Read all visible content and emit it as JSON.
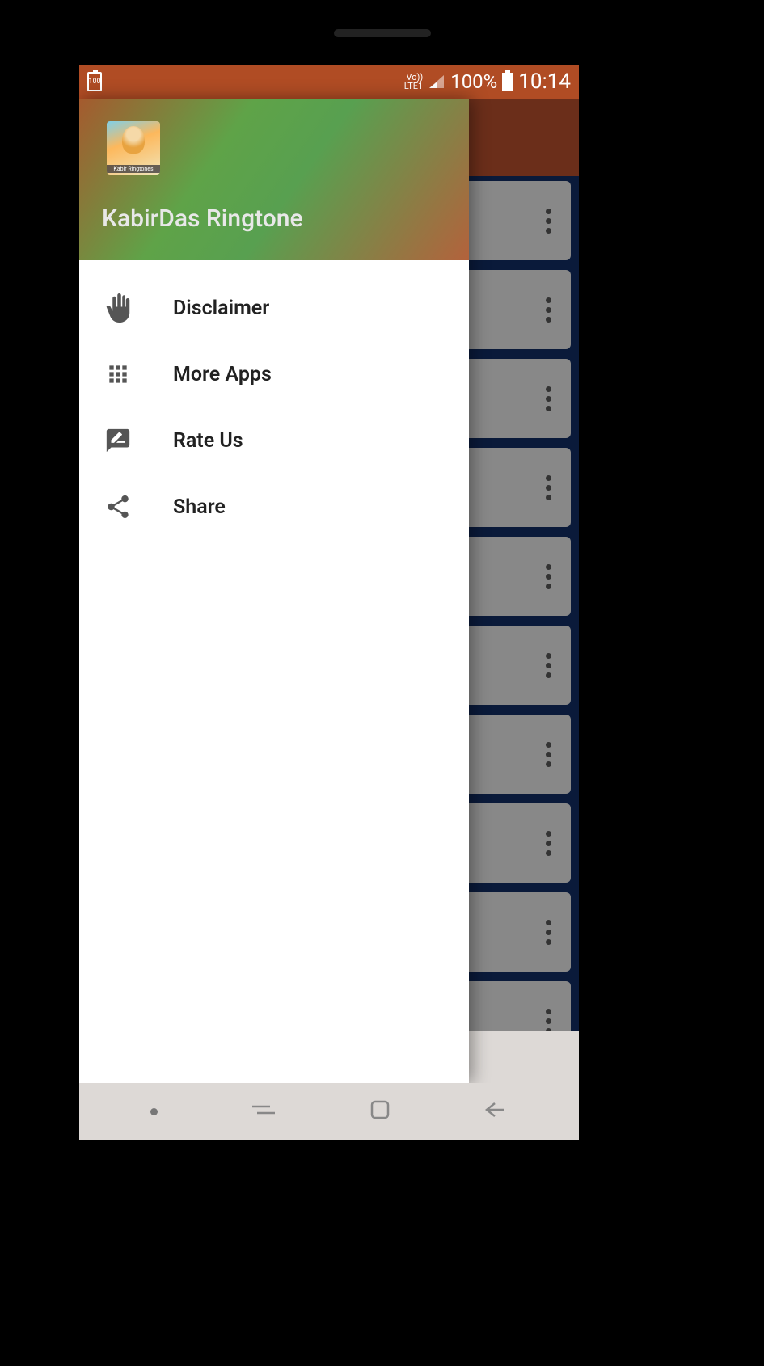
{
  "status_bar": {
    "battery_small_text": "100",
    "lte": "Vo))\nLTE1",
    "battery_percent": "100%",
    "time": "10:14"
  },
  "drawer": {
    "icon_caption": "Kabir Ringtones",
    "title": "KabirDas Ringtone",
    "menu": [
      {
        "label": "Disclaimer"
      },
      {
        "label": "More Apps"
      },
      {
        "label": "Rate Us"
      },
      {
        "label": "Share"
      }
    ]
  },
  "list_items_count": 10
}
